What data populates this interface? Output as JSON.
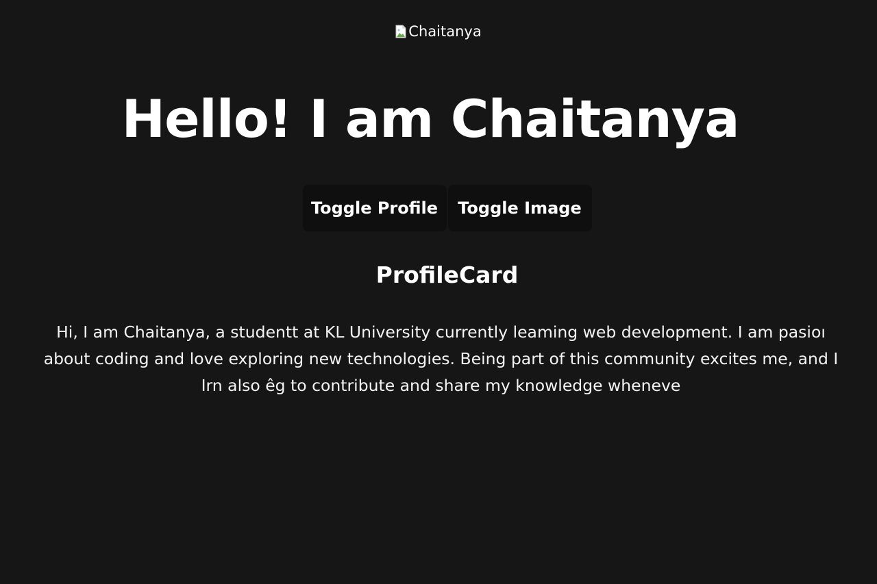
{
  "header": {
    "logo_alt": "Chaitanya",
    "logo_icon": "broken-image-icon"
  },
  "hero": {
    "title": "Hello! I am Chaitanya"
  },
  "buttons": {
    "toggle_profile": "Toggle Profile",
    "toggle_image": "Toggle Image"
  },
  "profile_card": {
    "title": "ProfileCard",
    "bio": "Hi, I am Chaitanya, a studentt at KL University currently leaming web development.  I am pasioı about coding and love exploring new technologies. Being part of this community excites me, and I Irn also êg to contribute and share my knowledge wheneve"
  },
  "colors": {
    "background": "#161616",
    "button_bg": "#0f0f0f",
    "text": "#ffffff"
  }
}
